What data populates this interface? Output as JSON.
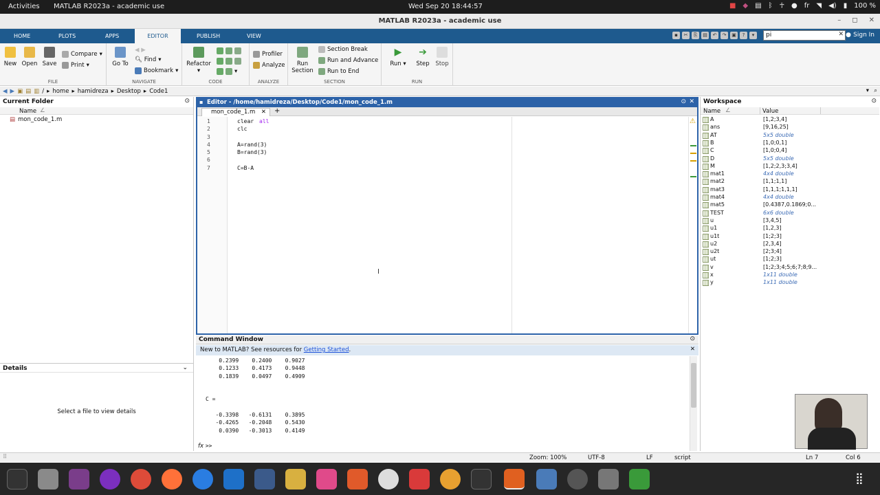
{
  "gnome": {
    "activities": "Activities",
    "app": "MATLAB R2023a - academic use",
    "clock": "Wed Sep 20  18:44:57",
    "lang": "fr",
    "battery": "100 %"
  },
  "window": {
    "title": "MATLAB R2023a - academic use"
  },
  "tabs": [
    "HOME",
    "PLOTS",
    "APPS",
    "EDITOR",
    "PUBLISH",
    "VIEW"
  ],
  "search": {
    "value": "pi"
  },
  "signin": "Sign In",
  "ribbon": {
    "file": {
      "label": "FILE",
      "new": "New",
      "open": "Open",
      "save": "Save",
      "compare": "Compare",
      "print": "Print"
    },
    "navigate": {
      "label": "NAVIGATE",
      "goto": "Go To",
      "find": "Find",
      "bookmark": "Bookmark"
    },
    "code": {
      "label": "CODE",
      "refactor": "Refactor"
    },
    "analyze": {
      "label": "ANALYZE",
      "profiler": "Profiler",
      "analyze": "Analyze"
    },
    "section": {
      "label": "SECTION",
      "run_section": "Run Section",
      "section_break": "Section Break",
      "run_advance": "Run and Advance",
      "run_end": "Run to End"
    },
    "run": {
      "label": "RUN",
      "run": "Run",
      "step": "Step",
      "stop": "Stop"
    }
  },
  "path": [
    "/",
    "home",
    "hamidreza",
    "Desktop",
    "Code1"
  ],
  "current_folder": {
    "title": "Current Folder",
    "col": "Name",
    "files": [
      "mon_code_1.m"
    ]
  },
  "details": {
    "title": "Details",
    "msg": "Select a file to view details"
  },
  "editor": {
    "title": "Editor - /home/hamidreza/Desktop/Code1/mon_code_1.m",
    "tab": "mon_code_1.m",
    "lines": [
      {
        "n": "1",
        "code": "clear ",
        "kw": "all"
      },
      {
        "n": "2",
        "code": "clc",
        "kw": ""
      },
      {
        "n": "3",
        "code": "",
        "kw": ""
      },
      {
        "n": "4",
        "code": "A=rand(3)",
        "kw": ""
      },
      {
        "n": "5",
        "code": "B=rand(3)",
        "kw": ""
      },
      {
        "n": "6",
        "code": "",
        "kw": ""
      },
      {
        "n": "7",
        "code": "C=B-A",
        "kw": ""
      }
    ]
  },
  "command": {
    "title": "Command Window",
    "banner": "New to MATLAB? See resources for ",
    "banner_link": "Getting Started",
    "banner_end": ".",
    "lines": [
      "    0.2399    0.2400    0.9027",
      "    0.1233    0.4173    0.9448",
      "    0.1839    0.0497    0.4909",
      "",
      "",
      "C =",
      "",
      "   -0.3398   -0.6131    0.3895",
      "   -0.4265   -0.2048    0.5430",
      "    0.0390   -0.3013    0.4149",
      ""
    ],
    "prompt": ">>"
  },
  "workspace": {
    "title": "Workspace",
    "col_name": "Name",
    "col_value": "Value",
    "vars": [
      {
        "name": "A",
        "value": "[1,2;3,4]",
        "it": false
      },
      {
        "name": "ans",
        "value": "[9,16,25]",
        "it": false
      },
      {
        "name": "AT",
        "value": "5x5 double",
        "it": true
      },
      {
        "name": "B",
        "value": "[1,0;0,1]",
        "it": false
      },
      {
        "name": "C",
        "value": "[1,0;0,4]",
        "it": false
      },
      {
        "name": "D",
        "value": "5x5 double",
        "it": true
      },
      {
        "name": "M",
        "value": "[1,2;2,3;3,4]",
        "it": false
      },
      {
        "name": "mat1",
        "value": "4x4 double",
        "it": true
      },
      {
        "name": "mat2",
        "value": "[1,1;1,1]",
        "it": false
      },
      {
        "name": "mat3",
        "value": "[1,1,1;1,1,1]",
        "it": false
      },
      {
        "name": "mat4",
        "value": "4x4 double",
        "it": true
      },
      {
        "name": "mat5",
        "value": "[0.4387,0.1869;0...",
        "it": false
      },
      {
        "name": "TEST",
        "value": "6x6 double",
        "it": true
      },
      {
        "name": "u",
        "value": "[3,4,5]",
        "it": false
      },
      {
        "name": "u1",
        "value": "[1,2,3]",
        "it": false
      },
      {
        "name": "u1t",
        "value": "[1;2;3]",
        "it": false
      },
      {
        "name": "u2",
        "value": "[2,3,4]",
        "it": false
      },
      {
        "name": "u2t",
        "value": "[2;3;4]",
        "it": false
      },
      {
        "name": "ut",
        "value": "[1;2;3]",
        "it": false
      },
      {
        "name": "v",
        "value": "[1;2;3;4;5;6;7;8;9...",
        "it": false
      },
      {
        "name": "x",
        "value": "1x11 double",
        "it": true
      },
      {
        "name": "y",
        "value": "1x11 double",
        "it": true
      }
    ]
  },
  "status": {
    "zoom": "Zoom: 100%",
    "enc": "UTF-8",
    "eol": "LF",
    "type": "script",
    "ln": "Ln  7",
    "col": "Col  6"
  }
}
